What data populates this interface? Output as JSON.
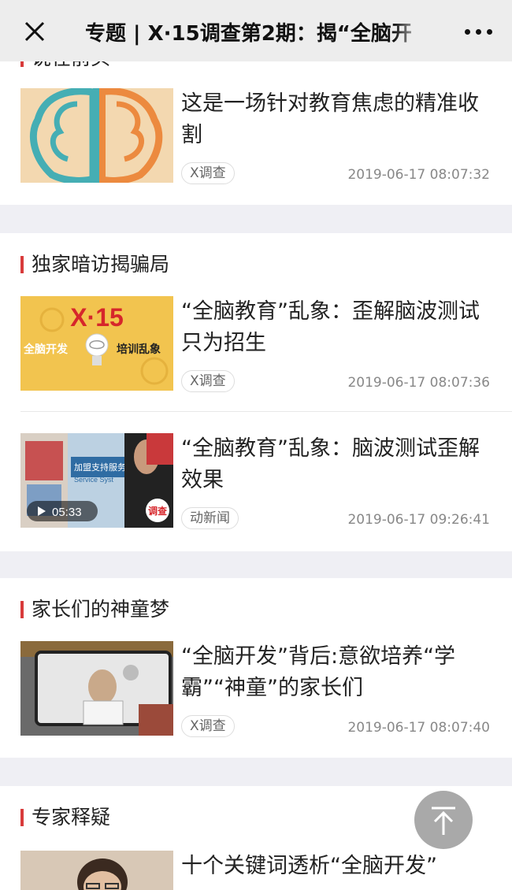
{
  "header": {
    "title": "专题 | X·15调查第2期：揭“全脑开"
  },
  "sections": [
    {
      "title": "说在前头",
      "items": [
        {
          "title": "这是一场针对教育焦虑的精准收割",
          "tag": "X调查",
          "time": "2019-06-17 08:07:32"
        }
      ]
    },
    {
      "title": "独家暗访揭骗局",
      "items": [
        {
          "title": "“全脑教育”乱象：歪解脑波测试只为招生",
          "tag": "X调查",
          "time": "2019-06-17 08:07:36",
          "thumb": {
            "brand": "X·15",
            "left": "全脑开发",
            "right": "培训乱象"
          }
        },
        {
          "title": "“全脑教育”乱象：脑波测试歪解效果",
          "tag": "动新闻",
          "time": "2019-06-17 09:26:41",
          "thumb": {
            "duration": "05:33",
            "badge": "调查",
            "sign": "加盟支持服务",
            "sign_en": "Service Syst"
          }
        }
      ]
    },
    {
      "title": "家长们的神童梦",
      "items": [
        {
          "title": "“全脑开发”背后:意欲培养“学霸”“神童”的家长们",
          "tag": "X调查",
          "time": "2019-06-17 08:07:40"
        }
      ]
    },
    {
      "title": "专家释疑",
      "items": [
        {
          "title": "十个关键词透析“全脑开发”"
        }
      ]
    }
  ]
}
